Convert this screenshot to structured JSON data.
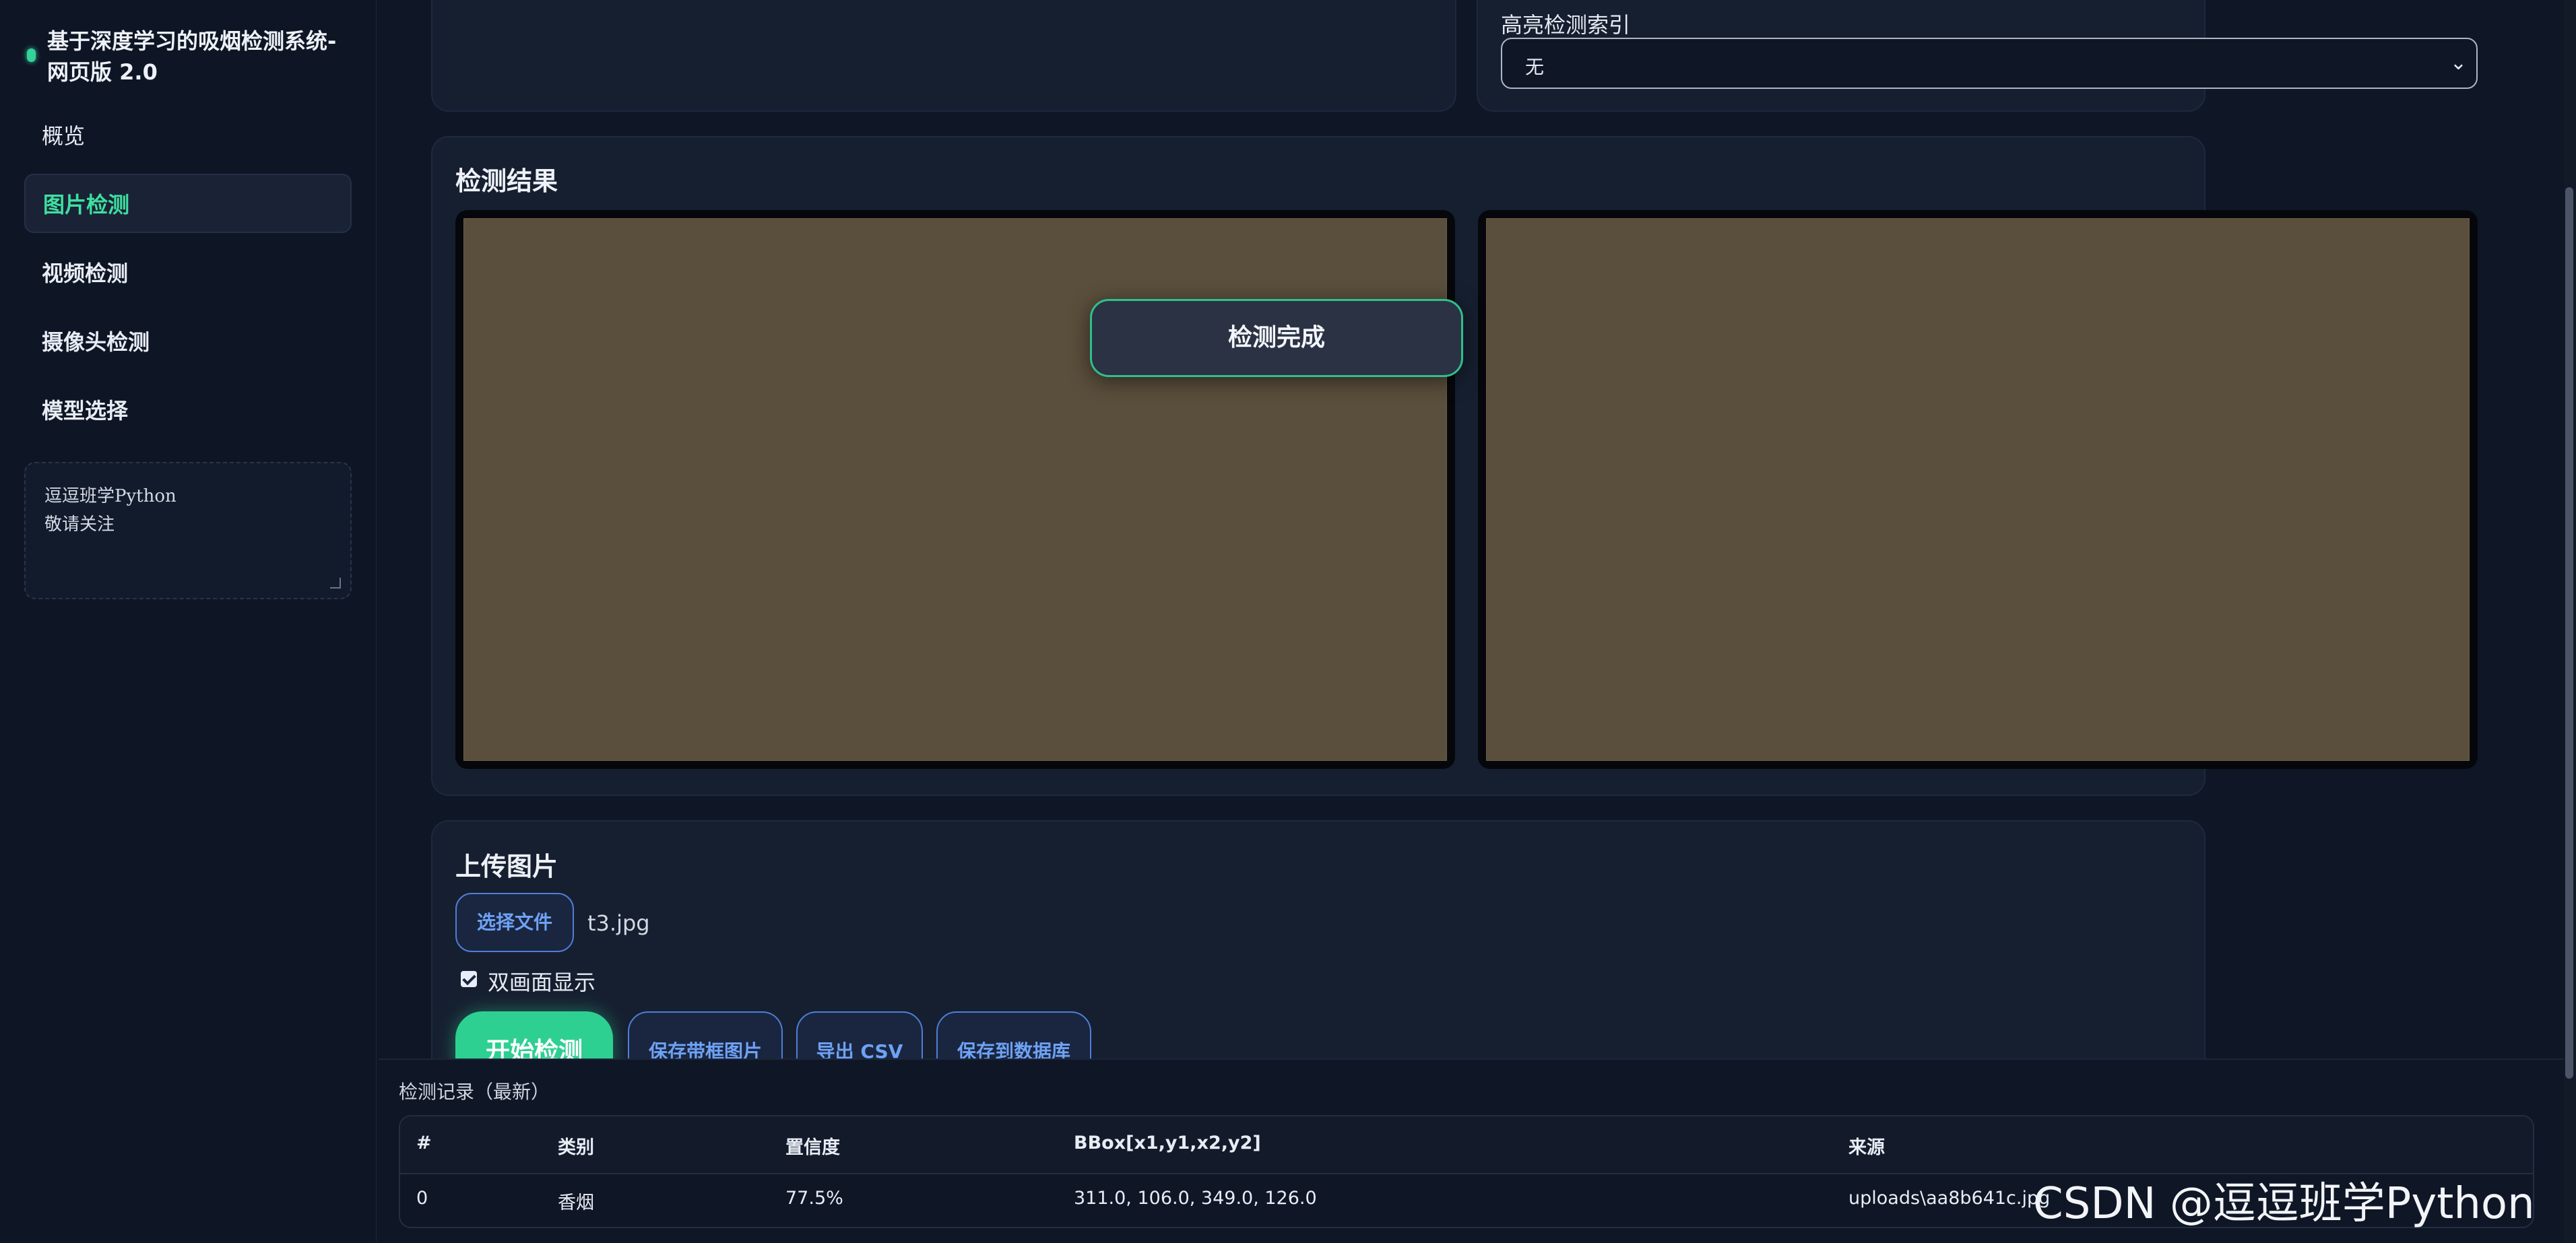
{
  "app": {
    "title": "基于深度学习的吸烟检测系统-网页版 2.0"
  },
  "sidebar": {
    "items": [
      {
        "label": "概览",
        "active": false
      },
      {
        "label": "图片检测",
        "active": true
      },
      {
        "label": "视频检测",
        "active": false
      },
      {
        "label": "摄像头检测",
        "active": false
      },
      {
        "label": "模型选择",
        "active": false
      }
    ],
    "note_text": "逗逗班学Python\n敬请关注"
  },
  "highlight": {
    "label": "高亮检测索引",
    "selected": "无"
  },
  "results": {
    "title": "检测结果",
    "toast": "检测完成",
    "images": [
      {
        "name": "original-image"
      },
      {
        "name": "result-image"
      }
    ]
  },
  "upload": {
    "title": "上传图片",
    "choose_file_label": "选择文件",
    "file_name": "t3.jpg",
    "dual_view_label": "双画面显示",
    "dual_view_checked": true,
    "start_label": "开始检测",
    "save_boxed_label": "保存带框图片",
    "export_csv_label": "导出 CSV",
    "save_db_label": "保存到数据库"
  },
  "records": {
    "label": "检测记录（最新）",
    "columns": [
      "#",
      "类别",
      "置信度",
      "BBox[x1,y1,x2,y2]",
      "来源"
    ],
    "rows": [
      [
        "0",
        "香烟",
        "77.5%",
        "311.0, 106.0, 349.0, 126.0",
        "uploads\\aa8b641c.jpg"
      ]
    ]
  },
  "watermark": "CSDN @逗逗班学Python",
  "colors": {
    "accent": "#2ed091",
    "link_blue": "#6ea2f5",
    "panel_bg": "#161f30",
    "page_bg": "#0f1626"
  }
}
